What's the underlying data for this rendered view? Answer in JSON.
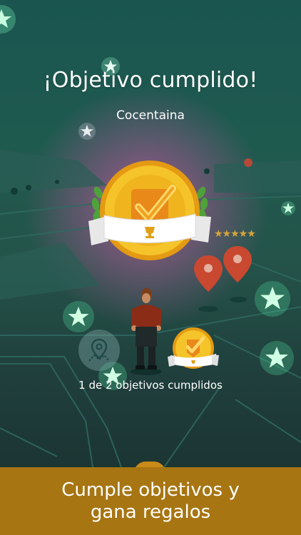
{
  "screen": {
    "title": "¡Objetivo cumplido!",
    "location": "Cocentaina",
    "progress_text": "1 de 2 objetivos cumplidos"
  },
  "promo": {
    "line1": "Cumple objetivos y",
    "line2": "gana regalos"
  },
  "icons": {
    "big_medal": "gold-checkmark-medal-icon",
    "small_medal": "gold-checkmark-medal-icon",
    "objective_marker": "map-route-pin-icon",
    "map_pins": "location-pin-icon",
    "sparkles": "star-sparkle-icon",
    "avatar": "player-avatar"
  },
  "colors": {
    "accent_gold": "#f2b81c",
    "footer_bg": "#a77512",
    "map_bg": "#1f5a4f",
    "glow_pink": "#d660a0",
    "pin_red": "#c84830",
    "sparkle_green": "#7cf0b0"
  }
}
